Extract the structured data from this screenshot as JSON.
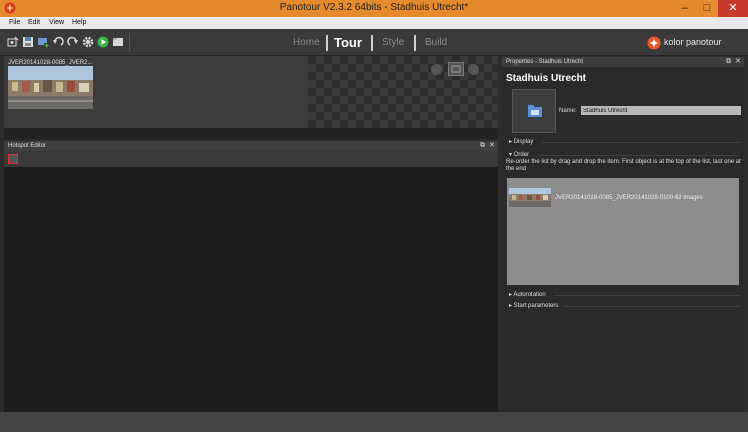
{
  "window": {
    "title": "Panotour V2.3.2 64bits - Stadhuis Utrecht*",
    "minimize": "–",
    "maximize": "□",
    "close": "✕"
  },
  "menu": [
    "File",
    "Edit",
    "View",
    "Help"
  ],
  "toolbar": {
    "icons": [
      "new-project-icon",
      "save-icon",
      "add-panorama-icon",
      "undo-icon",
      "redo-icon",
      "settings-icon",
      "build-play-icon",
      "open-folder-icon"
    ],
    "modes": [
      "Home",
      "Tour",
      "Style",
      "Build"
    ],
    "active_mode": "Tour",
    "brand": "kolor panotour"
  },
  "tour_strip": {
    "panorama_label": "JVER20141028-0085_JVER2..."
  },
  "hotspot_editor": {
    "title": "Hotspot Editor",
    "float_icon": "⧉",
    "close_icon": "✕"
  },
  "properties": {
    "header": "Properties - Stadhuis Utrecht",
    "float_icon": "⧉",
    "close_icon": "✕",
    "title": "Stadhuis Utrecht",
    "name_label": "Name:",
    "name_value": "Stadhuis Utrecht",
    "sections": {
      "display": "Display",
      "order": "Order",
      "autorotation": "Autorotation",
      "start_parameters": "Start parameters"
    },
    "order_description": "Re-order the list by drag and drop the item. First object is at the top of the list, last one at the end",
    "order_items": [
      "JVER20141028-0085_JVER20141028-0100-62 images"
    ]
  },
  "colors": {
    "titlebar": "#e68a2e",
    "accent": "#e8562a",
    "close_button": "#c7392b"
  }
}
